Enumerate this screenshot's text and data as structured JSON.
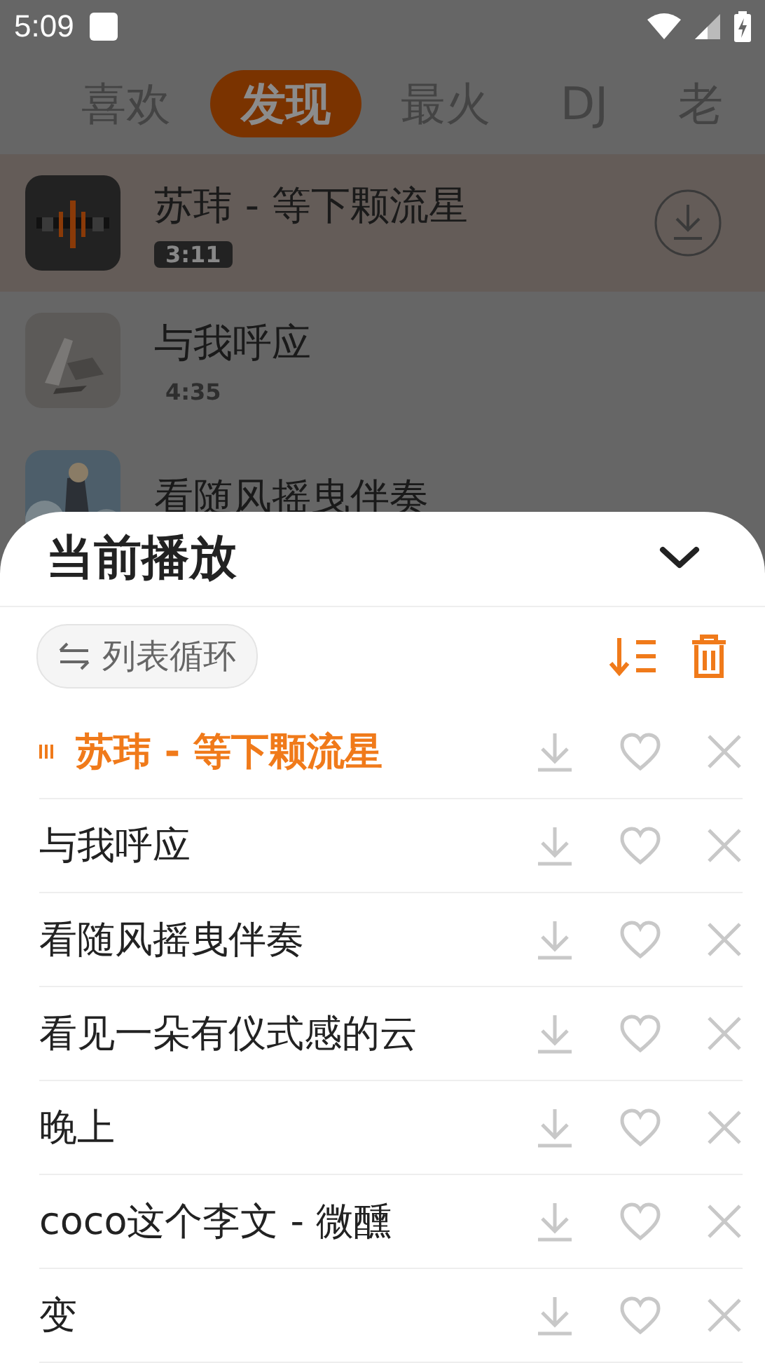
{
  "status_bar": {
    "time": "5:09"
  },
  "tabs": [
    {
      "label": "喜欢",
      "selected": false
    },
    {
      "label": "发现",
      "selected": true
    },
    {
      "label": "最火",
      "selected": false
    },
    {
      "label": "DJ",
      "selected": false
    },
    {
      "label": "老",
      "selected": false
    }
  ],
  "songs": [
    {
      "title": "苏玮 - 等下颗流星",
      "duration": "3:11",
      "selected": true,
      "download_button": true
    },
    {
      "title": "与我呼应",
      "duration": "4:35",
      "selected": false,
      "download_button": false
    },
    {
      "title": "看随风摇曳伴奏",
      "selected": false,
      "download_button": false
    }
  ],
  "sheet": {
    "title": "当前播放",
    "play_mode": "列表循环",
    "queue": [
      {
        "title": "苏玮 - 等下颗流星",
        "playing": true
      },
      {
        "title": "与我呼应",
        "playing": false
      },
      {
        "title": "看随风摇曳伴奏",
        "playing": false
      },
      {
        "title": "看见一朵有仪式感的云",
        "playing": false
      },
      {
        "title": "晚上",
        "playing": false
      },
      {
        "title": "coco这个李文 - 微醺",
        "playing": false
      },
      {
        "title": "变",
        "playing": false
      }
    ]
  }
}
